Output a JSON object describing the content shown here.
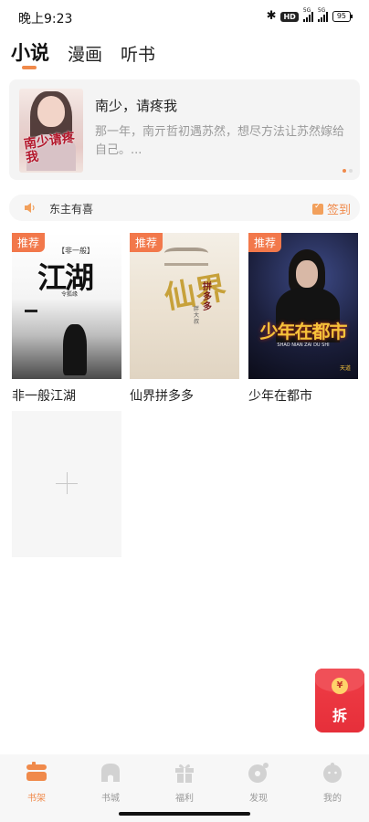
{
  "status_bar": {
    "time": "晚上9:23",
    "hd": "HD",
    "signal1": "5G",
    "signal2": "5G",
    "battery": "95"
  },
  "top_tabs": [
    {
      "label": "小说",
      "active": true
    },
    {
      "label": "漫画",
      "active": false
    },
    {
      "label": "听书",
      "active": false
    }
  ],
  "banner": {
    "title": "南少，请疼我",
    "description": "那一年，南亓哲初遇苏然，想尽方法让苏然嫁给自己。...",
    "cover_text": "南少请疼我",
    "slide_count": 2,
    "active_slide": 1
  },
  "notice": {
    "text": "东主有喜",
    "signin_label": "签到"
  },
  "books": [
    {
      "title": "非一般江湖",
      "tag": "推荐",
      "cover_text": "江湖",
      "cover_small": "【非一般】",
      "cover_author": "令狐缘"
    },
    {
      "title": "仙界拼多多",
      "tag": "推荐",
      "cover_text": "仙界",
      "cover_small": "拼多多",
      "cover_author": "胖大叔"
    },
    {
      "title": "少年在都市",
      "tag": "推荐",
      "cover_text": "少年在都市",
      "cover_small": "SHAO NIAN ZAI DU SHI",
      "cover_author": "天道"
    }
  ],
  "red_packet": {
    "coin": "¥",
    "label": "拆"
  },
  "bottom_nav": [
    {
      "label": "书架",
      "icon": "bookshelf-icon",
      "active": true
    },
    {
      "label": "书城",
      "icon": "bookstore-icon",
      "active": false
    },
    {
      "label": "福利",
      "icon": "gift-icon",
      "active": false
    },
    {
      "label": "发现",
      "icon": "discover-icon",
      "active": false
    },
    {
      "label": "我的",
      "icon": "profile-icon",
      "active": false
    }
  ],
  "colors": {
    "accent": "#f08a4b",
    "tag": "#f2784b",
    "red_packet": "#e62f3a",
    "inactive_nav": "#cccccc"
  }
}
